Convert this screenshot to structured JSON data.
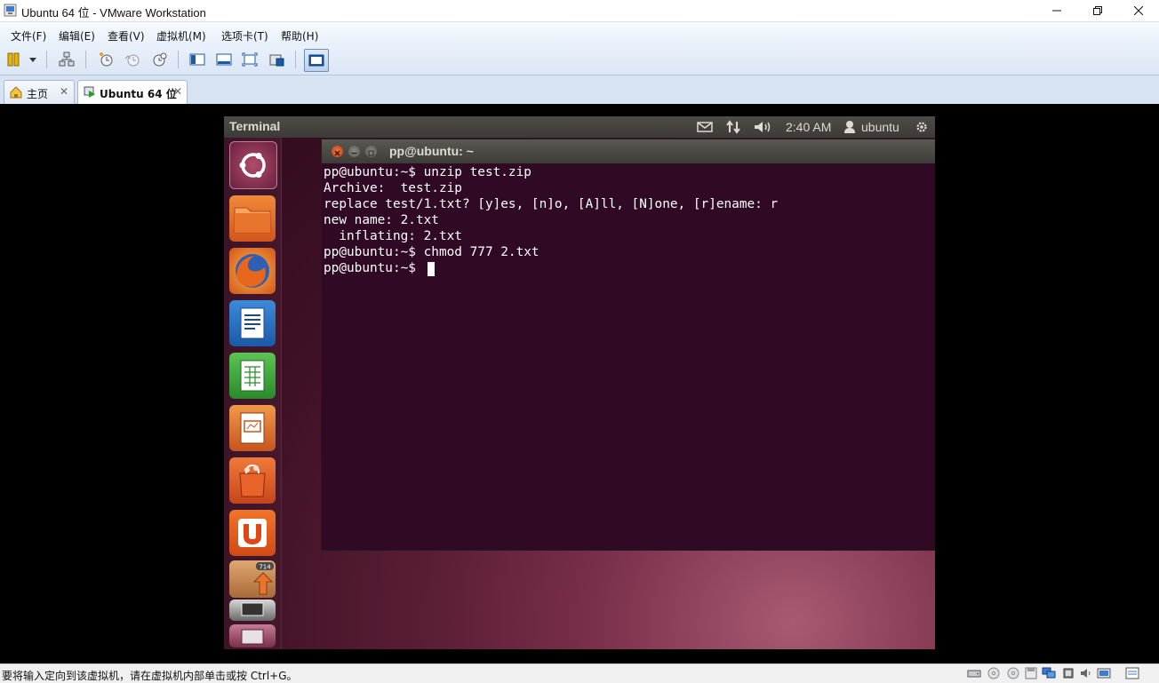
{
  "window": {
    "title": "Ubuntu 64 位 - VMware Workstation"
  },
  "menu": [
    "文件(F)",
    "编辑(E)",
    "查看(V)",
    "虚拟机(M)",
    "选项卡(T)",
    "帮助(H)"
  ],
  "tabs": [
    {
      "label": "主页",
      "active": false
    },
    {
      "label": "Ubuntu 64 位",
      "active": true
    }
  ],
  "guest": {
    "panel_title": "Terminal",
    "clock": "2:40 AM",
    "user": "ubuntu",
    "terminal_title": "pp@ubuntu: ~",
    "terminal_lines": [
      "pp@ubuntu:~$ unzip test.zip",
      "Archive:  test.zip",
      "replace test/1.txt? [y]es, [n]o, [A]ll, [N]one, [r]ename: r",
      "new name: 2.txt",
      "  inflating: 2.txt",
      "pp@ubuntu:~$ chmod 777 2.txt",
      "pp@ubuntu:~$ "
    ],
    "launcher_badge": "714",
    "launcher_items": [
      "dash-home-icon",
      "files-icon",
      "firefox-icon",
      "writer-icon",
      "calc-icon",
      "impress-icon",
      "software-center-icon",
      "ubuntu-one-icon",
      "update-manager-icon",
      "workspaces-icon",
      "trash-icon"
    ]
  },
  "statusbar": {
    "text": "要将输入定向到该虚拟机，请在虚拟机内部单击或按 Ctrl+G。"
  },
  "colors": {
    "terminal_bg": "#300a24",
    "launcher_orange": "#dd4814",
    "panel_bg": "#3c3b37"
  }
}
